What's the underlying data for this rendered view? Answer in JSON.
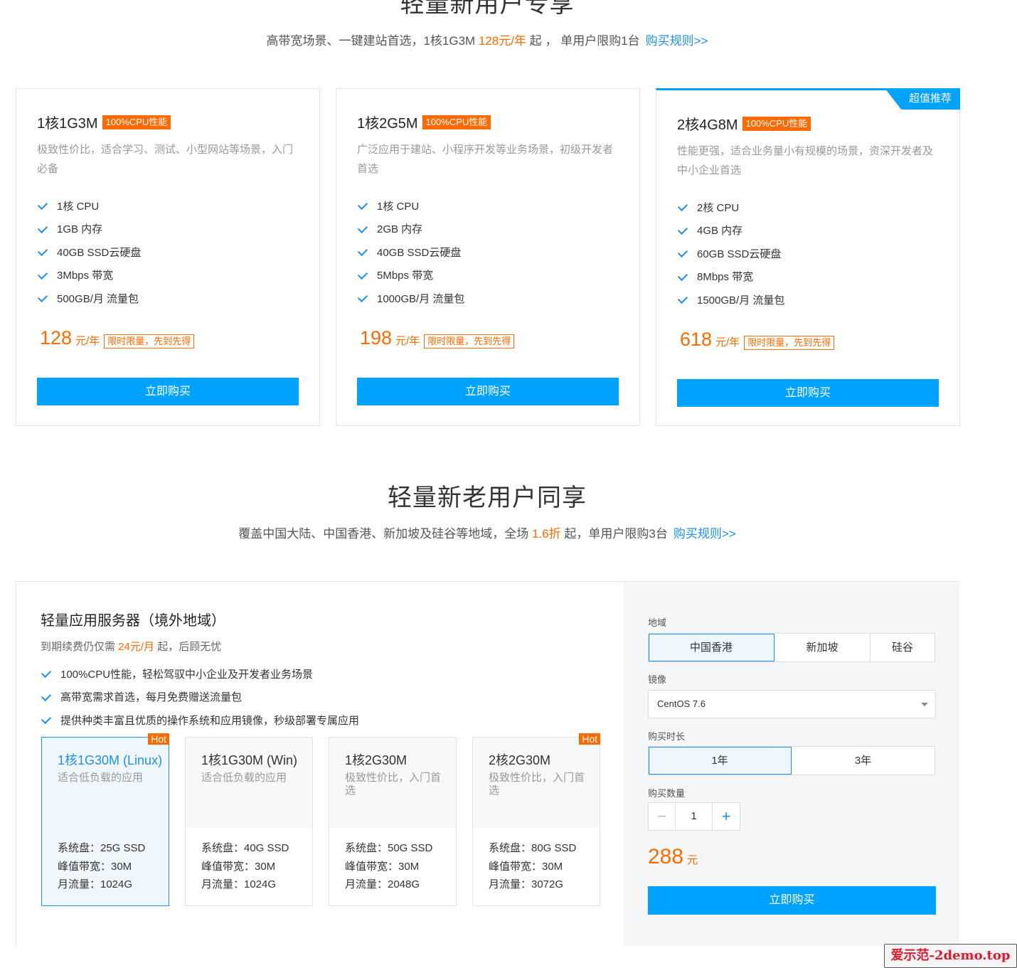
{
  "section1": {
    "title": "轻量新用户专享",
    "sub_pre": "高带宽场景、一键建站首选，1核1G3M ",
    "sub_price": "128元/年",
    "sub_post": " 起 ， 单用户限购1台",
    "sub_link": "购买规则>>"
  },
  "plans": [
    {
      "name": "1核1G3M",
      "badge": "100%CPU性能",
      "desc": "极致性价比，适合学习、测试、小型网站等场景，入门必备",
      "features": [
        "1核 CPU",
        "1GB 内存",
        "40GB SSD云硬盘",
        "3Mbps 带宽",
        "500GB/月 流量包"
      ],
      "price": "128",
      "unit": "元/年",
      "limit": "限时限量，先到先得",
      "button": "立即购买"
    },
    {
      "name": "1核2G5M",
      "badge": "100%CPU性能",
      "desc": "广泛应用于建站、小程序开发等业务场景，初级开发者首选",
      "features": [
        "1核 CPU",
        "2GB 内存",
        "40GB SSD云硬盘",
        "5Mbps 带宽",
        "1000GB/月 流量包"
      ],
      "price": "198",
      "unit": "元/年",
      "limit": "限时限量，先到先得",
      "button": "立即购买"
    },
    {
      "name": "2核4G8M",
      "badge": "100%CPU性能",
      "recommend": "超值推荐",
      "desc": "性能更强，适合业务量小有规模的场景，资深开发者及中小企业首选",
      "features": [
        "2核 CPU",
        "4GB 内存",
        "60GB SSD云硬盘",
        "8Mbps 带宽",
        "1500GB/月 流量包"
      ],
      "price": "618",
      "unit": "元/年",
      "limit": "限时限量，先到先得",
      "button": "立即购买"
    }
  ],
  "section2": {
    "title": "轻量新老用户同享",
    "sub_pre": "覆盖中国大陆、中国香港、新加坡及硅谷等地域，全场 ",
    "sub_discount": "1.6折",
    "sub_post": " 起，单用户限购3台",
    "sub_link": "购买规则>>"
  },
  "panel": {
    "title": "轻量应用服务器（境外地域）",
    "sub_pre": "到期续费仍仅需 ",
    "sub_price": "24元/月",
    "sub_post": " 起，后顾无忧",
    "features": [
      "100%CPU性能，轻松驾驭中小企业及开发者业务场景",
      "高带宽需求首选，每月免费赠送流量包",
      "提供种类丰富且优质的操作系统和应用镜像，秒级部署专属应用"
    ],
    "specs": [
      {
        "name": "1核1G30M (Linux)",
        "desc": "适合低负载的应用",
        "disk": "系统盘：25G SSD",
        "bw": "峰值带宽：30M",
        "traffic": "月流量：1024G",
        "hot": "Hot"
      },
      {
        "name": "1核1G30M (Win)",
        "desc": "适合低负载的应用",
        "disk": "系统盘：40G SSD",
        "bw": "峰值带宽：30M",
        "traffic": "月流量：1024G"
      },
      {
        "name": "1核2G30M",
        "desc": "极致性价比，入门首选",
        "disk": "系统盘：50G SSD",
        "bw": "峰值带宽：30M",
        "traffic": "月流量：2048G"
      },
      {
        "name": "2核2G30M",
        "desc": "极致性价比，入门首选",
        "disk": "系统盘：80G SSD",
        "bw": "峰值带宽：30M",
        "traffic": "月流量：3072G",
        "hot": "Hot"
      }
    ],
    "region_label": "地域",
    "regions": [
      "中国香港",
      "新加坡",
      "硅谷"
    ],
    "image_label": "镜像",
    "image_value": "CentOS 7.6",
    "duration_label": "购买时长",
    "durations": [
      "1年",
      "3年"
    ],
    "qty_label": "购买数量",
    "qty_minus": "−",
    "qty": "1",
    "qty_plus": "+",
    "total": "288",
    "total_unit": "元",
    "button": "立即购买"
  },
  "watermark": "爱示范-2demo.top",
  "colors": {
    "accent": "#00a2ff",
    "price": "#ff6a00",
    "link": "#1e8ff0"
  }
}
